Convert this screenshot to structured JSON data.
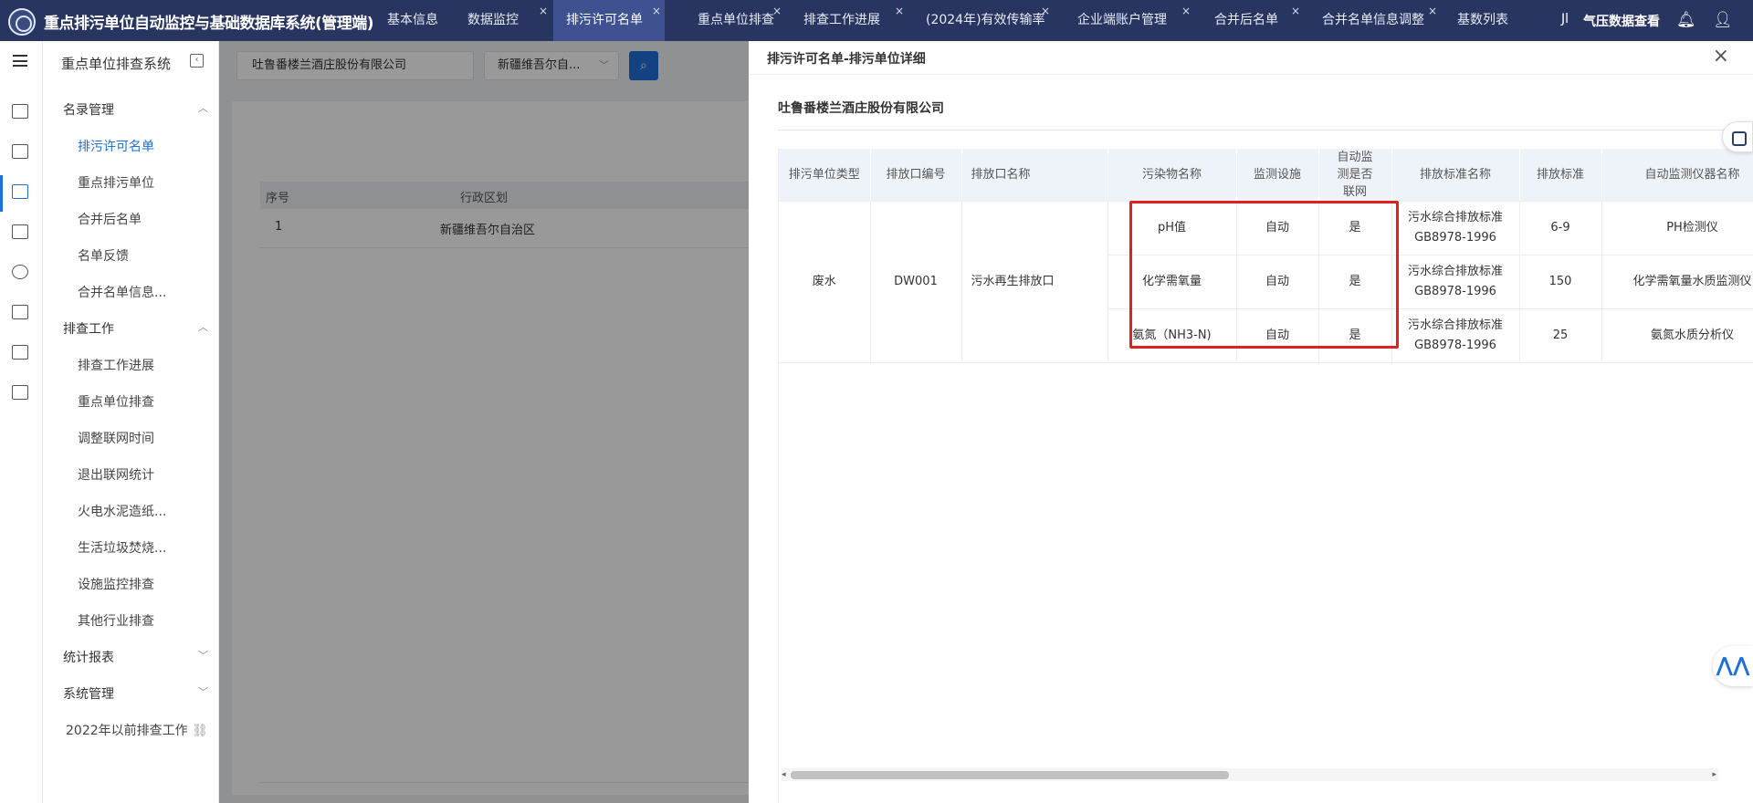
{
  "app": {
    "title": "重点排污单位自动监控与基础数据库系统(管理端)"
  },
  "tabs": [
    {
      "label": "基本信息",
      "closable": false,
      "active": false
    },
    {
      "label": "数据监控",
      "closable": true,
      "active": false
    },
    {
      "label": "排污许可名单",
      "closable": true,
      "active": true
    },
    {
      "label": "重点单位排查",
      "closable": true,
      "active": false
    },
    {
      "label": "排查工作进展",
      "closable": true,
      "active": false
    },
    {
      "label": "(2024年)有效传输率",
      "closable": true,
      "active": false
    },
    {
      "label": "企业端账户管理",
      "closable": true,
      "active": false
    },
    {
      "label": "合并后名单",
      "closable": true,
      "active": false
    },
    {
      "label": "合并名单信息调整",
      "closable": true,
      "active": false
    },
    {
      "label": "基数列表",
      "closable": false,
      "active": false
    }
  ],
  "topright": {
    "label": "气压数据查看",
    "icons": [
      "chart-icon",
      "bell-icon",
      "user-icon"
    ]
  },
  "sidebar": {
    "title": "重点单位排查系统",
    "groups": [
      {
        "label": "名录管理",
        "expanded": true
      },
      {
        "label": "排查工作",
        "expanded": true
      },
      {
        "label": "统计报表",
        "expanded": false
      },
      {
        "label": "系统管理",
        "expanded": false
      }
    ],
    "directory_items": [
      "排污许可名单",
      "重点排污单位",
      "合并后名单",
      "名单反馈",
      "合并名单信息..."
    ],
    "work_items": [
      "排查工作进展",
      "重点单位排查",
      "调整联网时间",
      "退出联网统计",
      "火电水泥造纸...",
      "生活垃圾焚烧...",
      "设施监控排查",
      "其他行业排查"
    ],
    "link": "2022年以前排查工作"
  },
  "search": {
    "value": "吐鲁番楼兰酒庄股份有限公司",
    "region": "新疆维吾尔自..."
  },
  "bg_table": {
    "headers": [
      "序号",
      "行政区划"
    ],
    "row": [
      "1",
      "新疆维吾尔自治区"
    ]
  },
  "drawer": {
    "title": "排污许可名单-排污单位详细",
    "company": "吐鲁番楼兰酒庄股份有限公司",
    "headers": [
      "排污单位类型",
      "排放口编号",
      "排放口名称",
      "污染物名称",
      "监测设施",
      "自动监测是否联网",
      "排放标准名称",
      "排放标准",
      "自动监测仪器名称"
    ],
    "unit_type": "废水",
    "outlet_code": "DW001",
    "outlet_name": "污水再生排放口",
    "rows": [
      {
        "pollutant": "pH值",
        "facility": "自动",
        "online": "是",
        "std_name": "污水综合排放标准GB8978-1996",
        "std_value": "6-9",
        "instrument": "PH检测仪"
      },
      {
        "pollutant": "化学需氧量",
        "facility": "自动",
        "online": "是",
        "std_name": "污水综合排放标准GB8978-1996",
        "std_value": "150",
        "instrument": "化学需氧量水质监测仪"
      },
      {
        "pollutant": "氨氮（NH3-N)",
        "facility": "自动",
        "online": "是",
        "std_name": "污水综合排放标准GB8978-1996",
        "std_value": "25",
        "instrument": "氨氮水质分析仪"
      }
    ]
  },
  "colors": {
    "topbar": "#283560",
    "active_tab": "#3f5190",
    "accent": "#1e6fd9",
    "highlight": "#e02020"
  }
}
